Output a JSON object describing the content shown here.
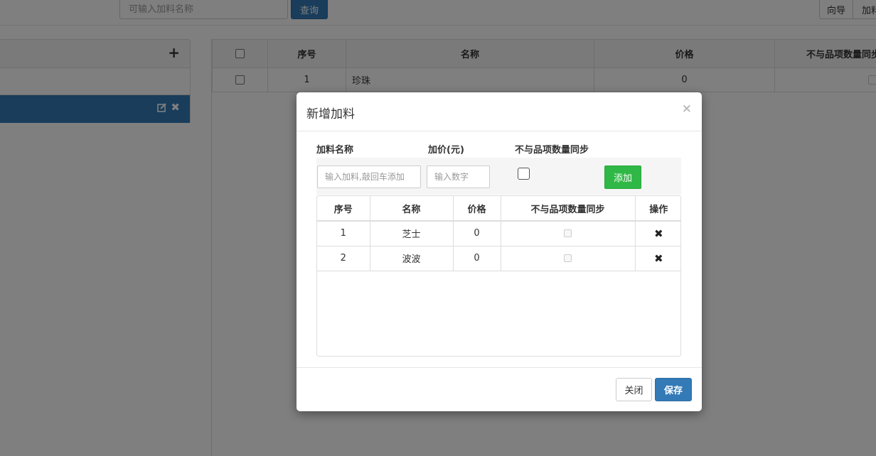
{
  "toolbar": {
    "search_placeholder": "可输入加料名称",
    "query_label": "查询",
    "guide_label": "向导",
    "addon_label": "加料"
  },
  "left_panel": {
    "add_icon": "plus-icon",
    "active_icons": [
      "edit-icon",
      "delete-icon"
    ]
  },
  "main_table": {
    "columns": [
      "序号",
      "名称",
      "价格",
      "不与品项数量同步"
    ],
    "rows": [
      {
        "index": "1",
        "name": "珍珠",
        "price": "0"
      }
    ]
  },
  "modal": {
    "title": "新增加料",
    "close_symbol": "×",
    "labels": {
      "name": "加料名称",
      "price": "加价(元)",
      "sync": "不与品项数量同步"
    },
    "name_placeholder": "输入加料,敲回车添加",
    "price_placeholder": "输入数字",
    "add_label": "添加",
    "list": {
      "columns": [
        "序号",
        "名称",
        "价格",
        "不与品项数量同步",
        "操作"
      ],
      "rows": [
        {
          "index": "1",
          "name": "芝士",
          "price": "0"
        },
        {
          "index": "2",
          "name": "波波",
          "price": "0"
        }
      ]
    },
    "close_label": "关闭",
    "save_label": "保存"
  },
  "colors": {
    "primary": "#337ab7",
    "success": "#2fb845"
  }
}
